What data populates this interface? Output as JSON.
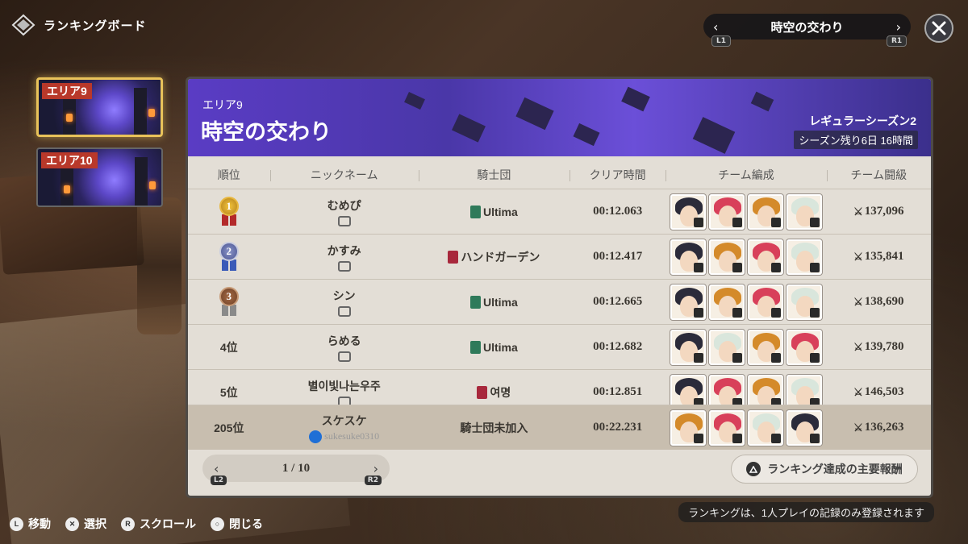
{
  "header": {
    "title": "ランキングボード",
    "area_selector": {
      "name": "時空の交わり",
      "left_hint": "L1",
      "right_hint": "R1"
    }
  },
  "areas": [
    {
      "label": "エリア9",
      "selected": true
    },
    {
      "label": "エリア10",
      "selected": false
    }
  ],
  "banner": {
    "area_label": "エリア9",
    "area_title": "時空の交わり",
    "season": "レギュラーシーズン2",
    "remaining": "シーズン残り6日 16時間"
  },
  "table": {
    "headers": [
      "順位",
      "ニックネーム",
      "騎士団",
      "クリア時間",
      "チーム編成",
      "チーム闘級"
    ],
    "rows": [
      {
        "rank": "1",
        "medal": "gold",
        "nickname": "むめぴ",
        "guild": "Ultima",
        "guild_color": "#2f7a5a",
        "time": "00:12.063",
        "power": "137,096",
        "team": [
          "black-hair",
          "pink-hair",
          "gold-goggles",
          "white-hair"
        ]
      },
      {
        "rank": "2",
        "medal": "silver",
        "nickname": "かすみ",
        "guild": "ハンドガーデン",
        "guild_color": "#a8283c",
        "time": "00:12.417",
        "power": "135,841",
        "team": [
          "black-hair",
          "gold-goggles",
          "pink-hair",
          "white-hair"
        ]
      },
      {
        "rank": "3",
        "medal": "bronze",
        "nickname": "シン",
        "guild": "Ultima",
        "guild_color": "#2f7a5a",
        "time": "00:12.665",
        "power": "138,690",
        "team": [
          "black-hair",
          "gold-goggles",
          "pink-hair",
          "white-hair"
        ]
      },
      {
        "rank": "4位",
        "medal": "",
        "nickname": "らめる",
        "guild": "Ultima",
        "guild_color": "#2f7a5a",
        "time": "00:12.682",
        "power": "139,780",
        "team": [
          "black-hair",
          "white-hair",
          "gold-goggles",
          "pink-hair"
        ]
      },
      {
        "rank": "5位",
        "medal": "",
        "nickname": "별이빛나는우주",
        "guild": "여명",
        "guild_color": "#a8283c",
        "time": "00:12.851",
        "power": "146,503",
        "team": [
          "black-hair",
          "pink-hair",
          "gold-goggles",
          "white-hair"
        ]
      }
    ],
    "self_row": {
      "rank": "205位",
      "nickname": "スケスケ",
      "psn_id": "sukesuke0310",
      "guild": "騎士団未加入",
      "time": "00:22.231",
      "power": "136,263",
      "team": [
        "gold-goggles",
        "pink-hair",
        "white-hair",
        "black-hair"
      ]
    }
  },
  "pager": {
    "text": "1 / 10",
    "left_hint": "L2",
    "right_hint": "R2"
  },
  "rewards_button": "ランキング達成の主要報酬",
  "note": "ランキングは、1人プレイの記録のみ登録されます",
  "controls": [
    {
      "key": "L",
      "label": "移動"
    },
    {
      "key": "✕",
      "label": "選択"
    },
    {
      "key": "R",
      "label": "スクロール"
    },
    {
      "key": "○",
      "label": "閉じる"
    }
  ],
  "colors": {
    "hair": {
      "black-hair": "#2b2b3a",
      "pink-hair": "#d8405a",
      "gold-goggles": "#d48a2a",
      "white-hair": "#d9e6dc"
    }
  }
}
